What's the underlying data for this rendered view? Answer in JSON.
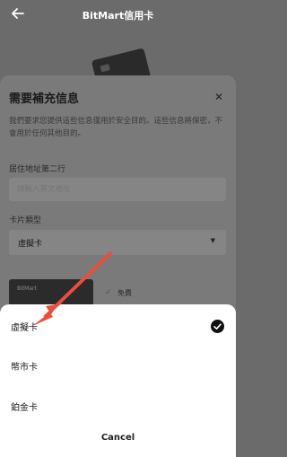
{
  "app": {
    "title": "BitMart信用卡"
  },
  "info_sheet": {
    "title": "需要補充信息",
    "description": "我們要求您提供這些信息僅用於安全目的。這些信息將保密，不會用於任何其他目的。",
    "address_line2_label": "居住地址第二行",
    "address_line2_placeholder": "請輸入英文地址",
    "card_type_label": "卡片類型",
    "card_type_value": "虛擬卡",
    "card_brand": "BitMart",
    "free_label": "免費"
  },
  "picker": {
    "options": [
      {
        "label": "虛擬卡",
        "selected": true
      },
      {
        "label": "幣市卡",
        "selected": false
      },
      {
        "label": "鉑金卡",
        "selected": false
      }
    ],
    "cancel_label": "Cancel"
  },
  "colors": {
    "annotation_arrow": "#e8503a",
    "overlay": "#6b6b6b"
  }
}
